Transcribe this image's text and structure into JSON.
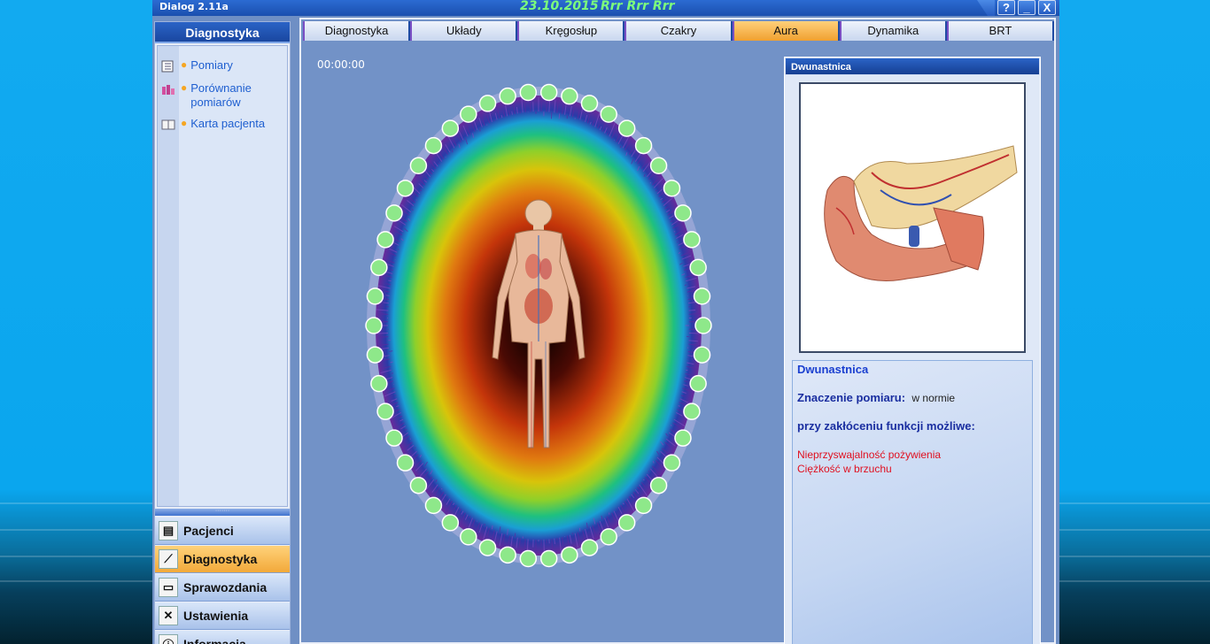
{
  "window": {
    "title": "Dialog 2.11a",
    "date": "23.10.2015",
    "status": "Rrr Rrr Rrr",
    "controls": [
      "?",
      "_",
      "X"
    ]
  },
  "sidebar": {
    "header": "Diagnostyka",
    "links": [
      {
        "label": "Pomiary",
        "icon": "list-icon"
      },
      {
        "label": "Porównanie pomiarów",
        "icon": "compare-icon"
      },
      {
        "label": "Karta pacjenta",
        "icon": "book-icon"
      }
    ],
    "splitter": "·······",
    "nav": [
      {
        "label": "Pacjenci",
        "icon": "patients-icon",
        "active": false
      },
      {
        "label": "Diagnostyka",
        "icon": "diagnostics-icon",
        "active": true
      },
      {
        "label": "Sprawozdania",
        "icon": "printer-icon",
        "active": false
      },
      {
        "label": "Ustawienia",
        "icon": "tools-icon",
        "active": false
      },
      {
        "label": "Informacja",
        "icon": "info-icon",
        "active": false
      }
    ]
  },
  "tabs": [
    {
      "label": "Diagnostyka",
      "active": false
    },
    {
      "label": "Układy",
      "active": false
    },
    {
      "label": "Kręgosłup",
      "active": false
    },
    {
      "label": "Czakry",
      "active": false
    },
    {
      "label": "Aura",
      "active": true
    },
    {
      "label": "Dynamika",
      "active": false
    },
    {
      "label": "BRT",
      "active": false
    }
  ],
  "aura": {
    "timer": "00:00:00",
    "point_count": 50,
    "point_color": "#8ee88a"
  },
  "info": {
    "header": "Dwunastnica",
    "organ": "Dwunastnica",
    "measurement_label": "Znaczenie pomiaru:",
    "measurement_value": "w normie",
    "possible_label": "przy zakłóceniu funkcji możliwe:",
    "possible": [
      "Nieprzyswajalność pożywienia",
      "Ciężkość w brzuchu"
    ]
  },
  "colors": {
    "title_date": "#7cff7c",
    "active_tab": "#f0a030",
    "link": "#1f5fd0",
    "warning_text": "#e01020"
  }
}
